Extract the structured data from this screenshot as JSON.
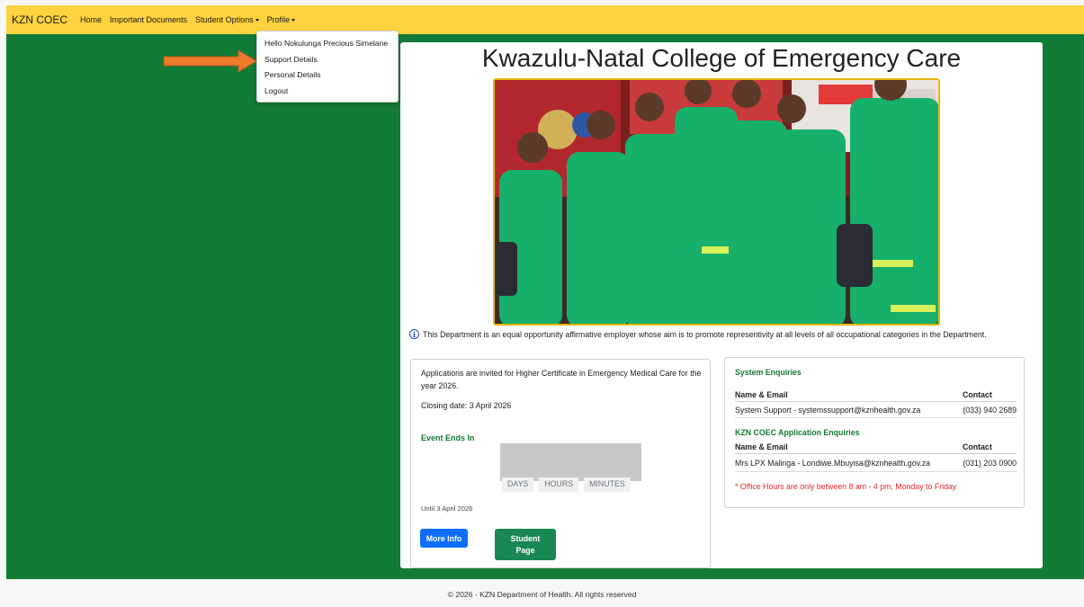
{
  "navbar": {
    "brand": "KZN COEC",
    "links": [
      {
        "label": "Home"
      },
      {
        "label": "Important Documents"
      },
      {
        "label": "Student Options"
      },
      {
        "label": "Profile"
      }
    ]
  },
  "profile_menu": {
    "items": [
      "Hello Nokulunga Precious Simelane",
      "Support Details",
      "Personal Details",
      "Logout"
    ]
  },
  "main": {
    "title": "Kwazulu-Natal College of Emergency Care",
    "notice": "This Department is an equal opportunity affirmative employer whose aim is to promote representivity at all levels of all occupational categories in the Department."
  },
  "applications": {
    "intro_line1": "Applications are invited for Higher Certificate in Emergency Medical Care for the",
    "intro_line2": "year 2026.",
    "closing_date": "Closing date: 3 April 2026",
    "event_label": "Event Ends In",
    "countdown_labels": [
      "DAYS",
      "HOURS",
      "MINUTES"
    ],
    "until": "Until 3 April 2026",
    "more_info_button": "More Info",
    "student_button_line1": "Student",
    "student_button_line2": "Page"
  },
  "enquiries": {
    "system_heading": "System Enquiries",
    "col_name": "Name & Email",
    "col_contact": "Contact",
    "system_row": {
      "name": "System Support - systemssupport@kznhealth.gov.za",
      "contact": "(033) 940 2689"
    },
    "application_heading": "KZN COEC Application Enquiries",
    "application_row": {
      "name": "Mrs LPX Malinga - Londiwe.Mbuyisa@kznhealth.gov.za",
      "contact": "(031) 203 0900"
    },
    "note": "* Office Hours are only between 8 am - 4 pm, Monday to Friday"
  },
  "footer": {
    "text": "© 2026 - KZN Department of Health. All rights reserved"
  },
  "colors": {
    "navbar": "#ffd23f",
    "background_green": "#127b35",
    "accent_green": "#198754",
    "primary_blue": "#0d6efd",
    "alert_red": "#e0282c"
  }
}
